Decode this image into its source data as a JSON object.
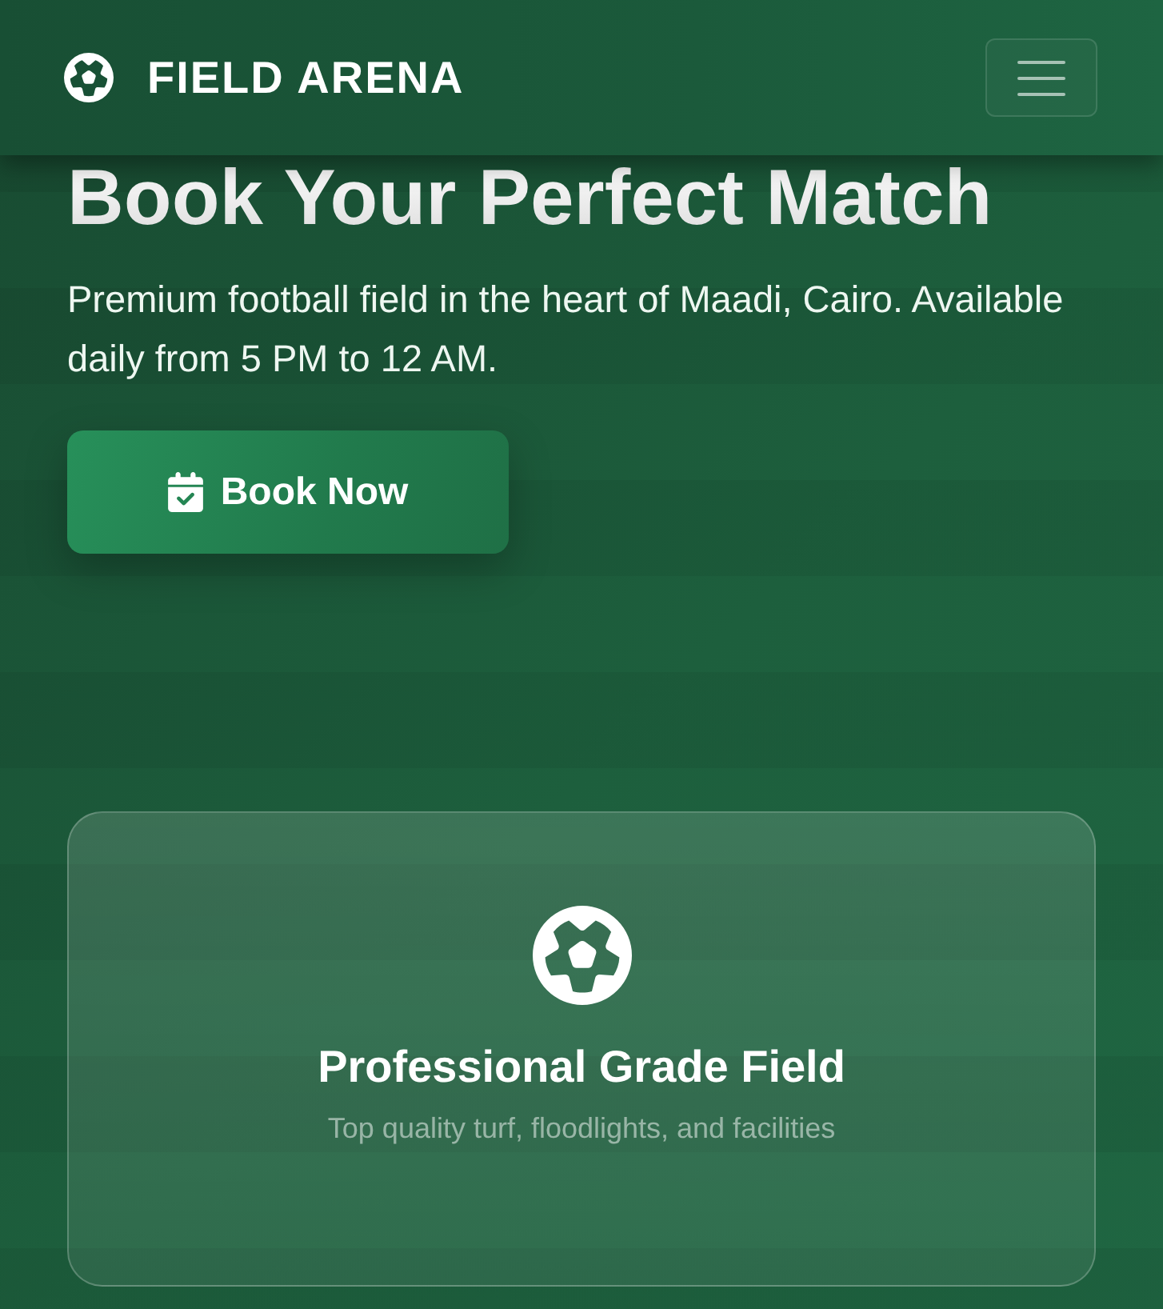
{
  "navbar": {
    "brand": "FIELD ARENA"
  },
  "hero": {
    "title": "Book Your Perfect Match",
    "description": "Premium football field in the heart of Maadi, Cairo. Available daily from 5 PM to 12 AM.",
    "button": "Book Now"
  },
  "feature_card": {
    "title": "Professional Grade Field",
    "description": "Top quality turf, floodlights, and facilities"
  }
}
